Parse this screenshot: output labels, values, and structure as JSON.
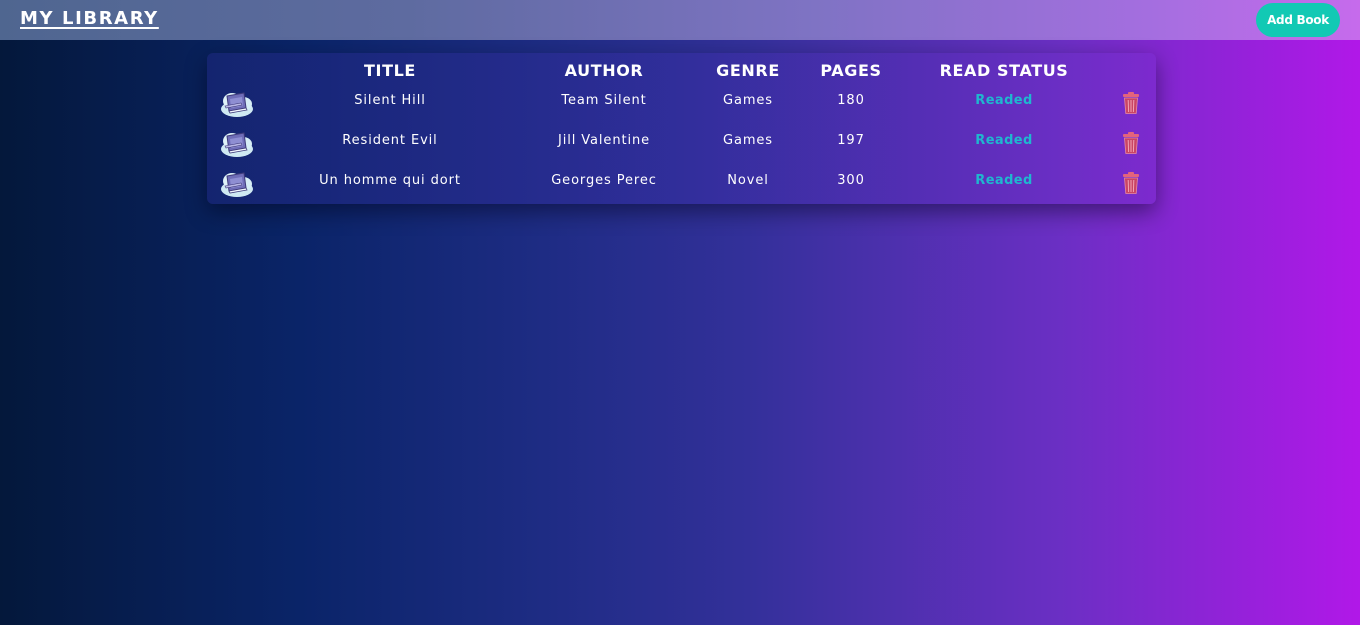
{
  "app": {
    "title": "MY LIBRARY",
    "add_button_label": "Add Book"
  },
  "table": {
    "headers": {
      "title": "TITLE",
      "author": "AUTHOR",
      "genre": "GENRE",
      "pages": "PAGES",
      "status": "READ STATUS"
    },
    "rows": [
      {
        "title": "Silent Hill",
        "author": "Team Silent",
        "genre": "Games",
        "pages": "180",
        "status": "Readed",
        "icon": "book-stack-icon"
      },
      {
        "title": "Resident Evil",
        "author": "Jill Valentine",
        "genre": "Games",
        "pages": "197",
        "status": "Readed",
        "icon": "book-stack-icon"
      },
      {
        "title": "Un homme qui dort",
        "author": "Georges Perec",
        "genre": "Novel",
        "pages": "300",
        "status": "Readed",
        "icon": "book-stack-icon"
      }
    ]
  },
  "colors": {
    "accent": "#12c9b4",
    "status_text": "#1fb7cf",
    "delete": "#e4647c"
  },
  "icons": {
    "row_icon": "book-stack-icon",
    "delete_icon": "trash-icon"
  }
}
